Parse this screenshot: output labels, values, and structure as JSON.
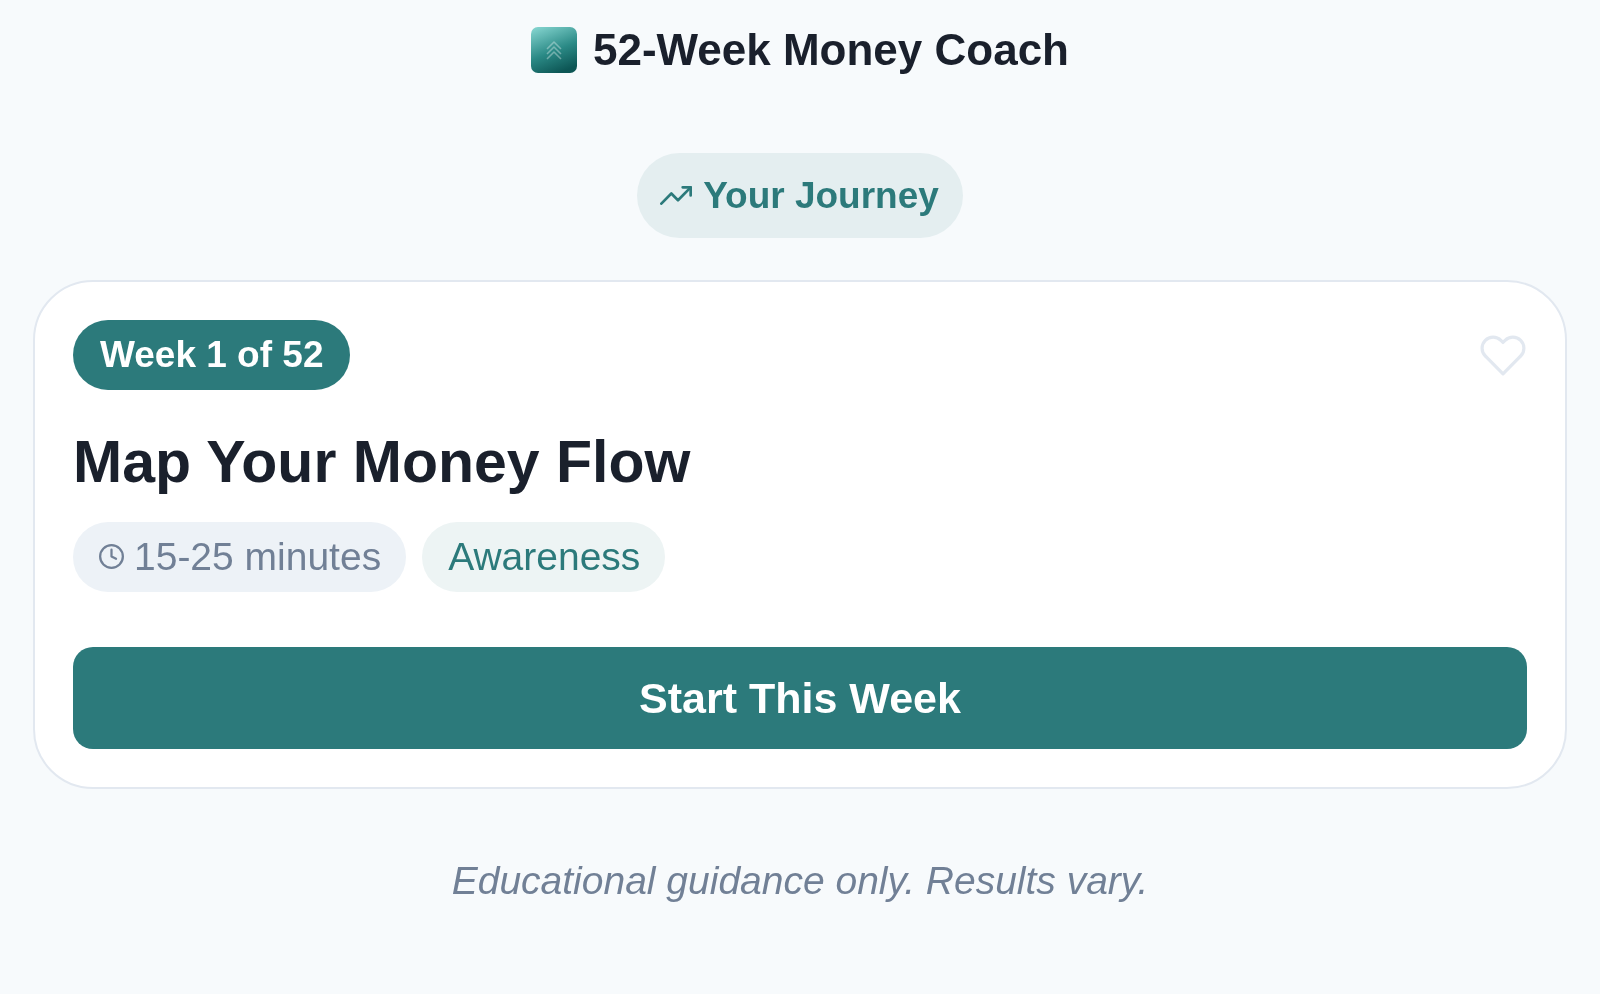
{
  "header": {
    "title": "52-Week Money Coach"
  },
  "journey_pill": {
    "label": "Your Journey"
  },
  "week_card": {
    "badge": "Week 1 of 52",
    "favorite": false,
    "title": "Map Your Money Flow",
    "tags": [
      {
        "kind": "duration",
        "label": "15-25 minutes"
      },
      {
        "kind": "category",
        "label": "Awareness"
      }
    ],
    "button": "Start This Week"
  },
  "footer": {
    "note": "Educational guidance only. Results vary."
  }
}
